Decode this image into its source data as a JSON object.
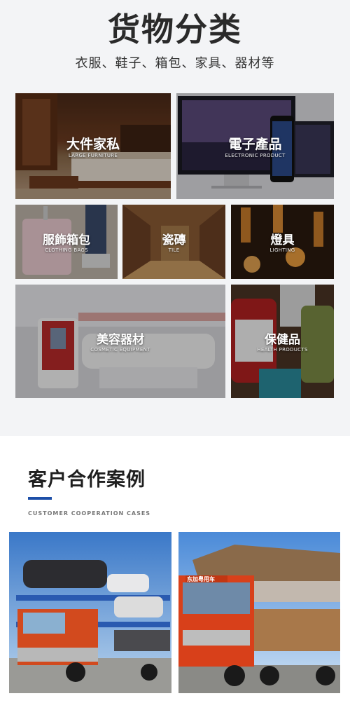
{
  "header": {
    "title": "货物分类",
    "subtitle": "衣服、鞋子、箱包、家具、器材等"
  },
  "categories": [
    {
      "cn": "大件家私",
      "en": "LARGE FURNITURE",
      "icon": "furniture-image"
    },
    {
      "cn": "電子產品",
      "en": "ELECTRONIC PRODUCT",
      "icon": "electronics-image"
    },
    {
      "cn": "服飾箱包",
      "en": "CLOTHING BAGS",
      "icon": "clothing-bags-image"
    },
    {
      "cn": "瓷磚",
      "en": "TILE",
      "icon": "tile-image"
    },
    {
      "cn": "燈具",
      "en": "LIGHTING",
      "icon": "lighting-image"
    },
    {
      "cn": "美容器材",
      "en": "COSMETIC EQUIPMENT",
      "icon": "cosmetic-equipment-image"
    },
    {
      "cn": "保健品",
      "en": "HEALTH PRODUCTS",
      "icon": "health-products-image"
    }
  ],
  "cases": {
    "title": "客户合作案例",
    "subtitle_en": "CUSTOMER COOPERATION CASES",
    "accent": "#1d4fa8",
    "photos": [
      {
        "icon": "car-carrier-truck-photo"
      },
      {
        "icon": "cargo-truck-photo",
        "truck_sign": "东加粤用车"
      }
    ]
  }
}
